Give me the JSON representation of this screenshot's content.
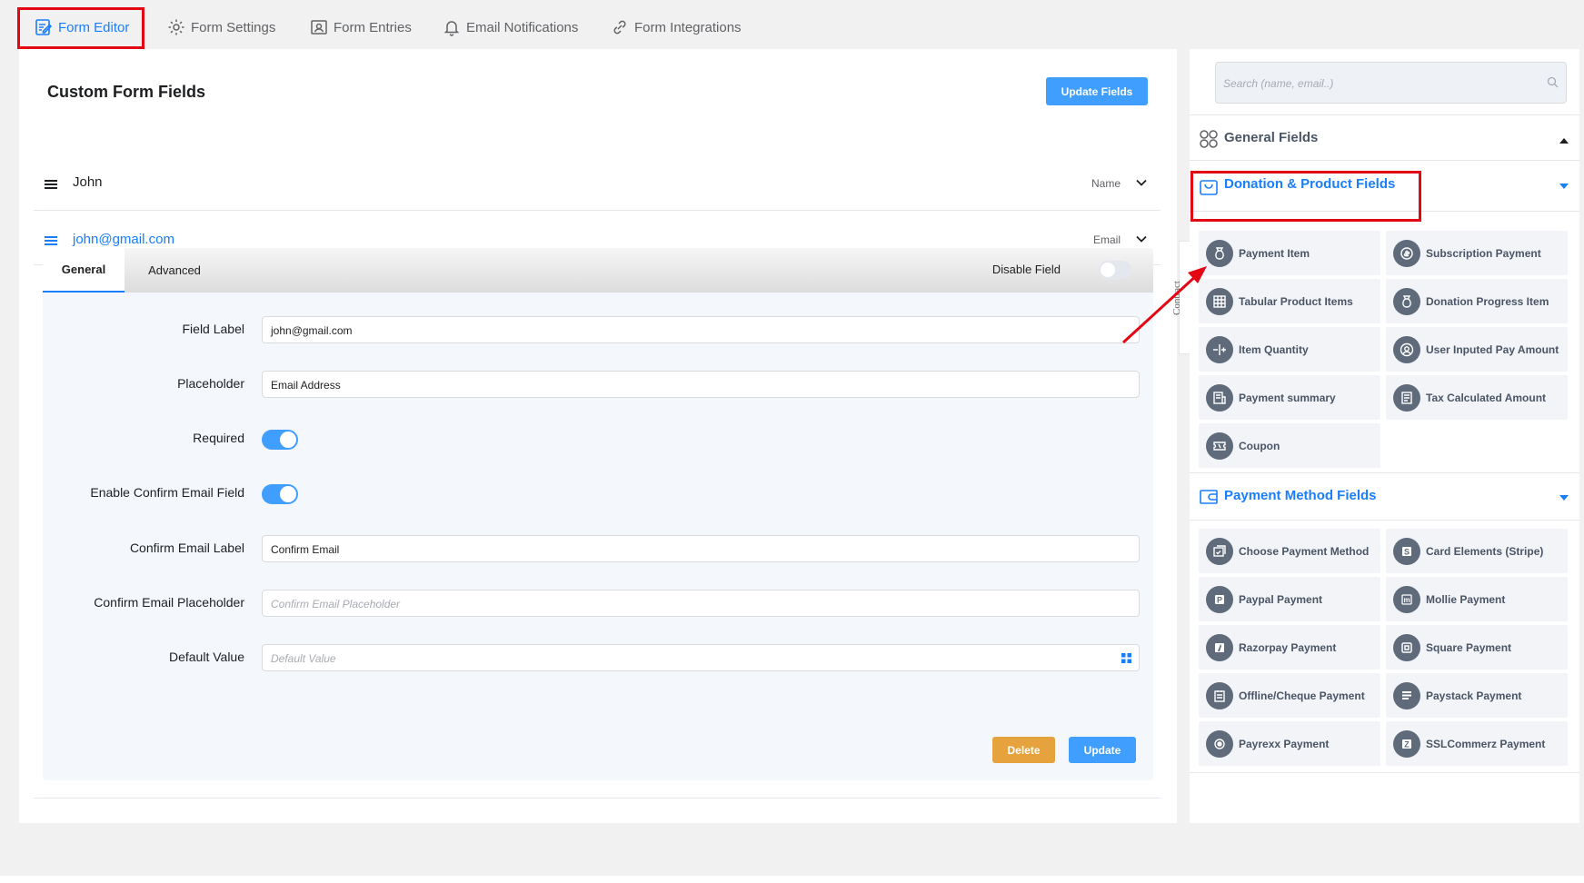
{
  "nav": {
    "tabs": [
      {
        "label": "Form Editor",
        "icon": "edit-form-icon"
      },
      {
        "label": "Form Settings",
        "icon": "gear-icon"
      },
      {
        "label": "Form Entries",
        "icon": "user-card-icon"
      },
      {
        "label": "Email Notifications",
        "icon": "bell-icon"
      },
      {
        "label": "Form Integrations",
        "icon": "link-icon"
      }
    ]
  },
  "main": {
    "title": "Custom Form Fields",
    "update_fields_label": "Update Fields",
    "fields": [
      {
        "label": "John",
        "type": "Name"
      },
      {
        "label": "john@gmail.com",
        "type": "Email"
      }
    ]
  },
  "editor": {
    "tab_general": "General",
    "tab_advanced": "Advanced",
    "disable_field_label": "Disable Field",
    "disable_field_on": false,
    "rows": {
      "field_label": {
        "label": "Field Label",
        "value": "john@gmail.com"
      },
      "placeholder": {
        "label": "Placeholder",
        "value": "Email Address"
      },
      "required": {
        "label": "Required",
        "on": true
      },
      "enable_confirm": {
        "label": "Enable Confirm Email Field",
        "on": true
      },
      "confirm_label": {
        "label": "Confirm Email Label",
        "value": "Confirm Email"
      },
      "confirm_placeholder": {
        "label": "Confirm Email Placeholder",
        "placeholder": "Confirm Email Placeholder"
      },
      "default_value": {
        "label": "Default Value",
        "placeholder": "Default Value"
      }
    },
    "delete_label": "Delete",
    "update_label": "Update"
  },
  "side": {
    "collapse_label": "Contract",
    "search_placeholder": "Search (name, email..)",
    "general_fields_title": "General Fields",
    "donation_title": "Donation & Product Fields",
    "donation_items": [
      {
        "label": "Payment Item",
        "icon": "money-bag-icon"
      },
      {
        "label": "Subscription Payment",
        "icon": "coin-icon"
      },
      {
        "label": "Tabular Product Items",
        "icon": "table-icon"
      },
      {
        "label": "Donation Progress Item",
        "icon": "money-bag-icon"
      },
      {
        "label": "Item Quantity",
        "icon": "plus-minus-icon"
      },
      {
        "label": "User Inputed Pay Amount",
        "icon": "user-circle-icon"
      },
      {
        "label": "Payment summary",
        "icon": "receipt-icon"
      },
      {
        "label": "Tax Calculated Amount",
        "icon": "document-icon"
      },
      {
        "label": "Coupon",
        "icon": "ticket-icon"
      }
    ],
    "payment_method_title": "Payment Method Fields",
    "payment_items": [
      {
        "label": "Choose Payment Method",
        "icon": "card-check-icon"
      },
      {
        "label": "Card Elements (Stripe)",
        "icon": "stripe-icon"
      },
      {
        "label": "Paypal Payment",
        "icon": "paypal-icon"
      },
      {
        "label": "Mollie Payment",
        "icon": "mollie-icon"
      },
      {
        "label": "Razorpay Payment",
        "icon": "razorpay-icon"
      },
      {
        "label": "Square Payment",
        "icon": "square-icon"
      },
      {
        "label": "Offline/Cheque Payment",
        "icon": "cheque-icon"
      },
      {
        "label": "Paystack Payment",
        "icon": "paystack-icon"
      },
      {
        "label": "Payrexx Payment",
        "icon": "payrexx-icon"
      },
      {
        "label": "SSLCommerz Payment",
        "icon": "sslcommerz-icon"
      }
    ]
  },
  "colors": {
    "accent": "#1a7efb",
    "button": "#409eff",
    "delete": "#e6a23c",
    "highlight": "#e30613"
  }
}
